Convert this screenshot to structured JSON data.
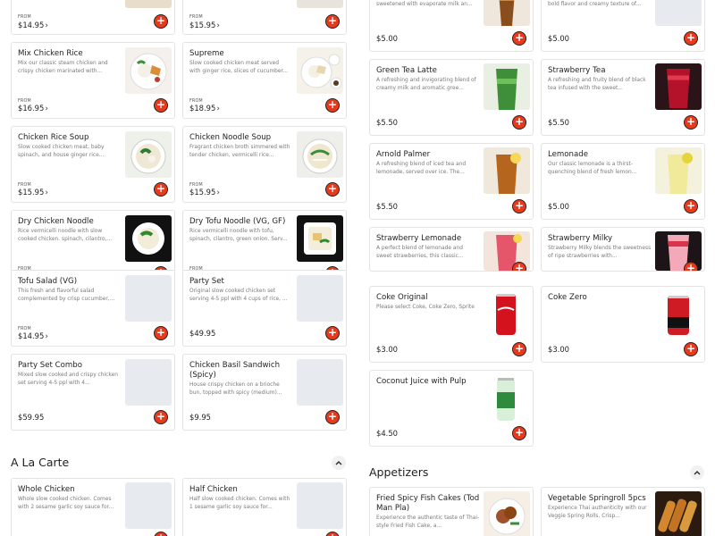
{
  "left_top": [
    {
      "from": "FROM",
      "price": "$14.95"
    },
    {
      "from": "FROM",
      "price": "$15.95"
    }
  ],
  "left_items": [
    {
      "title": "Mix Chicken Rice",
      "desc": "Mix our classic steam chicken and crispy chicken marinated with...",
      "from": "FROM",
      "price": "$16.95"
    },
    {
      "title": "Supreme",
      "desc": "Slow cooked chicken meat served with ginger rice, slices of cucumber...",
      "from": "FROM",
      "price": "$18.95"
    },
    {
      "title": "Chicken Rice Soup",
      "desc": "Slow cooked chicken meat, baby spinach, and house ginger rice...",
      "from": "FROM",
      "price": "$15.95"
    },
    {
      "title": "Chicken Noodle Soup",
      "desc": "Fragrant chicken broth simmered with tender chicken, vermicelli rice...",
      "from": "FROM",
      "price": "$15.95"
    },
    {
      "title": "Dry Chicken Noodle",
      "desc": "Rice vermicelli noodle with slow cooked chicken. spinach, cilantro,...",
      "from": "FROM"
    },
    {
      "title": "Dry Tofu Noodle (VG, GF)",
      "desc": "Rice vermicelli noodle with tofu, spinach, cilantro, green onion. Serv...",
      "from": "FROM"
    },
    {
      "title": "Tofu Salad (VG)",
      "desc": "This fresh and flavorful salad complemented by crisp cucumber,...",
      "from": "FROM",
      "price": "$14.95"
    },
    {
      "title": "Party Set",
      "desc": "Original slow cooked chicken set serving 4-5 ppl with 4 cups of rice, ...",
      "price": "$49.95"
    },
    {
      "title": "Party Set Combo",
      "desc": "Mixed slow cooked and crispy chicken set serving 4-5 ppl with 4...",
      "price": "$59.95"
    },
    {
      "title": "Chicken Basil Sandwich (Spicy)",
      "desc": "House crispy chicken on a brioche bun, topped with spicy (medium)...",
      "price": "$9.95"
    }
  ],
  "sections": {
    "a_la_carte": "A La Carte",
    "appetizers": "Appetizers"
  },
  "a_la_carte_items": [
    {
      "title": "Whole Chicken",
      "desc": "Whole slow cooked chicken. Comes with 2 sesame garlic soy sauce for..."
    },
    {
      "title": "Half Chicken",
      "desc": "Half slow cooked chicken. Comes with 1 sesame garlic soy sauce for..."
    }
  ],
  "right_top": [
    {
      "desc": "sweetened with evaporate milk an...",
      "price": "$5.00"
    },
    {
      "desc": "bold flavor and creamy texture of...",
      "price": "$5.00"
    }
  ],
  "drinks": [
    {
      "title": "Green Tea Latte",
      "desc": "A refreshing and invigorating blend of creamy milk and aromatic gree...",
      "price": "$5.50"
    },
    {
      "title": "Strawberry Tea",
      "desc": "A refreshing and fruity blend of black tea infused with the sweet...",
      "price": "$5.50"
    },
    {
      "title": "Arnold Palmer",
      "desc": "A refreshing blend of iced tea and lemonade, served over ice. The...",
      "price": "$5.50"
    },
    {
      "title": "Lemonade",
      "desc": "Our classic lemonade is a thirst-quenching blend of fresh lemon...",
      "price": "$5.00"
    },
    {
      "title": "Strawberry Lemonade",
      "desc": "A perfect blend of lemonade and sweet strawberries, this classic..."
    },
    {
      "title": "Strawberry Milky",
      "desc": "Strawberry Milky blends the sweetness of ripe strawberries with..."
    },
    {
      "title": "Coke Original",
      "desc": "Please select Coke, Coke Zero, Sprite",
      "price": "$3.00"
    },
    {
      "title": "Coke Zero",
      "desc": "",
      "price": "$3.00"
    },
    {
      "title": "Coconut Juice with Pulp",
      "desc": "",
      "price": "$4.50"
    }
  ],
  "appetizer_items": [
    {
      "title": "Fried Spicy Fish Cakes (Tod Man Pla)",
      "desc": "Experience the authentic taste of Thai-style Fried Fish Cake, a..."
    },
    {
      "title": "Vegetable Springroll 5pcs",
      "desc": "Experience Thai authenticity with our Veggie Spring Rolls. Crisp..."
    }
  ],
  "icons": {
    "add": "plus-icon",
    "chevron": "chevron-right-icon",
    "collapse": "chevron-up-icon"
  },
  "colors": {
    "accent": "#e8391d",
    "border": "#e3e3e3",
    "placeholder": "#e7eaef"
  }
}
